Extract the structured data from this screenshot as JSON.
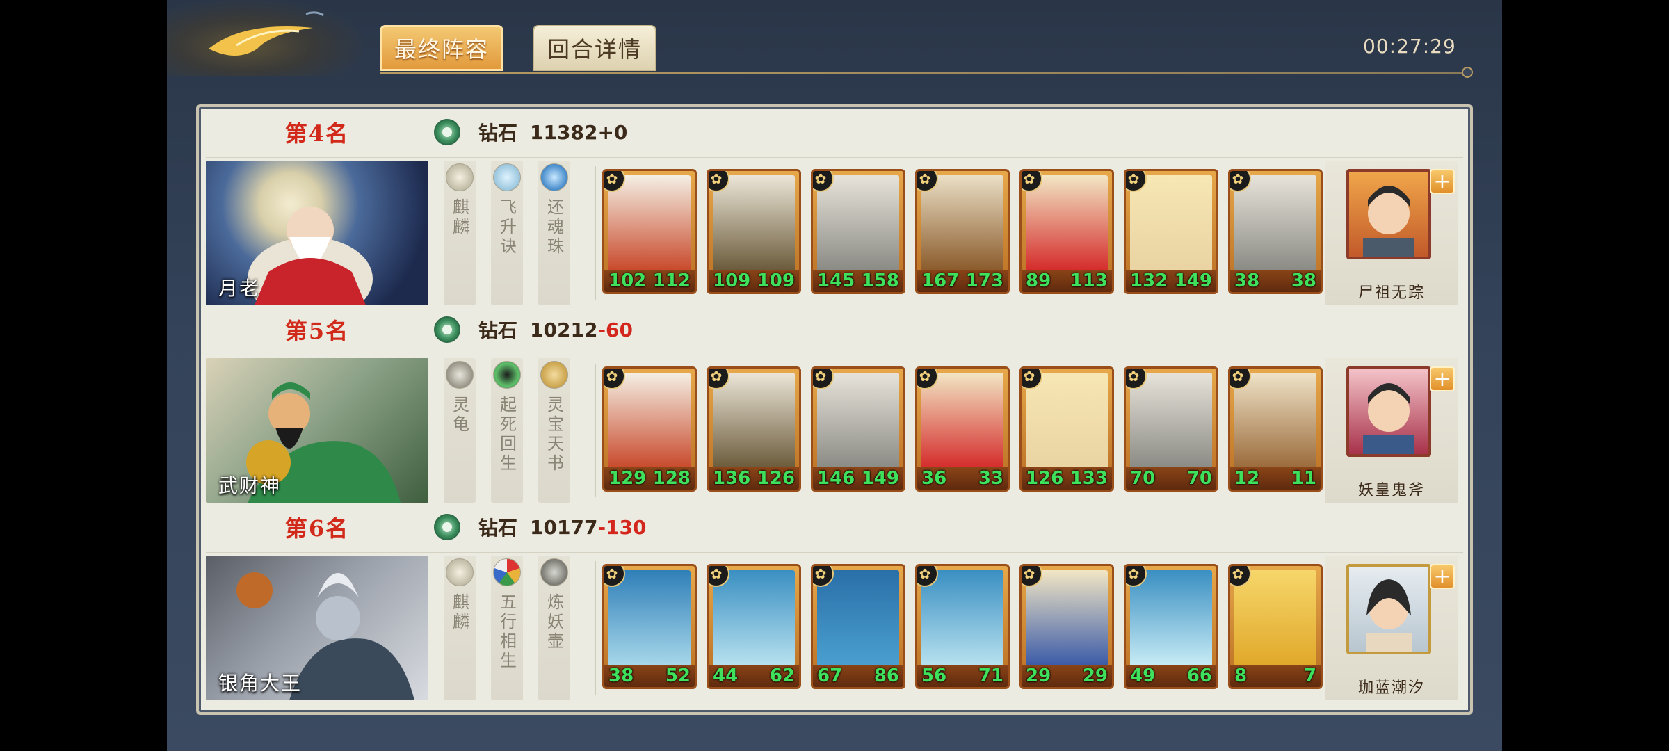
{
  "header": {
    "tabs": [
      {
        "label": "最终阵容",
        "active": true
      },
      {
        "label": "回合详情",
        "active": false
      }
    ],
    "timer": "00:27:29"
  },
  "rows": [
    {
      "rank": "第4名",
      "tier": "钻石",
      "score": "11382",
      "delta": "+0",
      "delta_sign": "pos",
      "hero_name": "月老",
      "treasures": [
        "麒麟",
        "飞升诀",
        "还魂珠"
      ],
      "cards": [
        {
          "a": "102",
          "b": "112"
        },
        {
          "a": "109",
          "b": "109"
        },
        {
          "a": "145",
          "b": "158"
        },
        {
          "a": "167",
          "b": "173"
        },
        {
          "a": "89",
          "b": "113"
        },
        {
          "a": "132",
          "b": "149"
        },
        {
          "a": "38",
          "b": "38"
        }
      ],
      "player_name": "尸祖无踪"
    },
    {
      "rank": "第5名",
      "tier": "钻石",
      "score": "10212",
      "delta": "-60",
      "delta_sign": "neg",
      "hero_name": "武财神",
      "treasures": [
        "灵龟",
        "起死回生",
        "灵宝天书"
      ],
      "cards": [
        {
          "a": "129",
          "b": "128"
        },
        {
          "a": "136",
          "b": "126"
        },
        {
          "a": "146",
          "b": "149"
        },
        {
          "a": "36",
          "b": "33"
        },
        {
          "a": "126",
          "b": "133"
        },
        {
          "a": "70",
          "b": "70"
        },
        {
          "a": "12",
          "b": "11"
        }
      ],
      "player_name": "妖皇鬼斧"
    },
    {
      "rank": "第6名",
      "tier": "钻石",
      "score": "10177",
      "delta": "-130",
      "delta_sign": "neg",
      "hero_name": "银角大王",
      "treasures": [
        "麒麟",
        "五行相生",
        "炼妖壶"
      ],
      "cards": [
        {
          "a": "38",
          "b": "52"
        },
        {
          "a": "44",
          "b": "62"
        },
        {
          "a": "67",
          "b": "86"
        },
        {
          "a": "56",
          "b": "71"
        },
        {
          "a": "29",
          "b": "29"
        },
        {
          "a": "49",
          "b": "66"
        },
        {
          "a": "8",
          "b": "7"
        }
      ],
      "player_name": "珈蓝潮汐"
    }
  ],
  "card_badge_icon": "clover-icon",
  "plus_icon": "+"
}
